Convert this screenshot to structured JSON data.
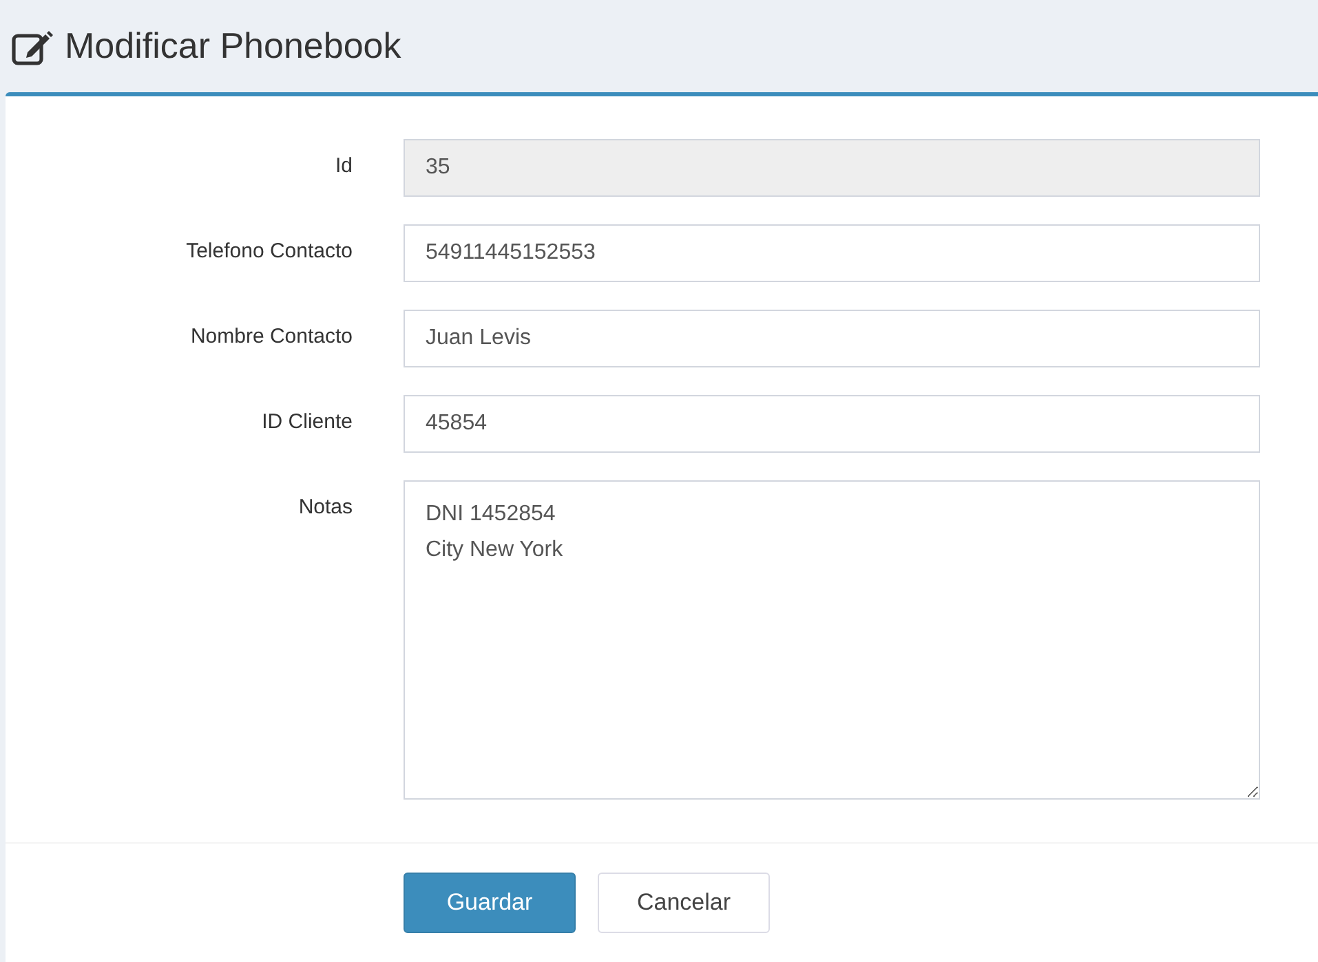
{
  "page": {
    "title": "Modificar Phonebook"
  },
  "form": {
    "fields": [
      {
        "label": "Id",
        "kind": "input",
        "value": "35",
        "disabled": true
      },
      {
        "label": "Telefono Contacto",
        "kind": "input",
        "value": "54911445152553",
        "disabled": false
      },
      {
        "label": "Nombre Contacto",
        "kind": "input",
        "value": "Juan Levis",
        "disabled": false
      },
      {
        "label": "ID Cliente",
        "kind": "input",
        "value": "45854",
        "disabled": false
      },
      {
        "label": "Notas",
        "kind": "textarea",
        "value": "DNI 1452854\nCity New York",
        "disabled": false
      }
    ]
  },
  "buttons": [
    {
      "label": "Guardar",
      "kind": "primary"
    },
    {
      "label": "Cancelar",
      "kind": "default"
    }
  ]
}
